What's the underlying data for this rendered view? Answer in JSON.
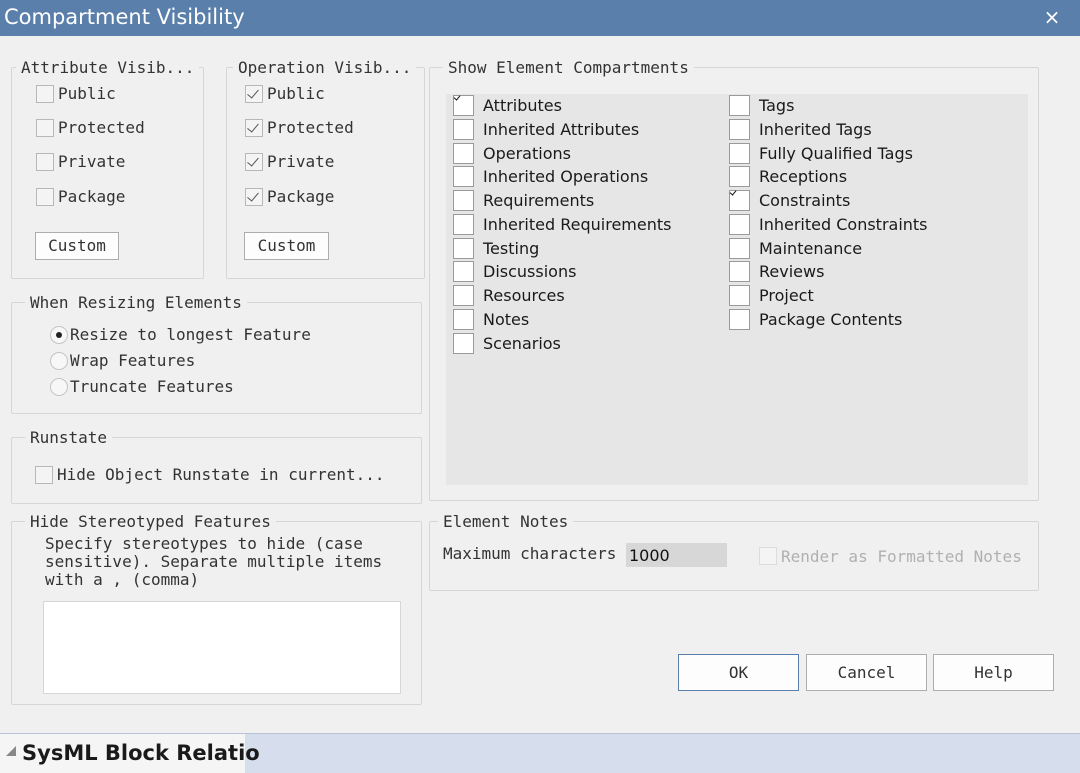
{
  "window": {
    "title": "Compartment Visibility",
    "close_glyph": "×"
  },
  "attribute_visibility": {
    "legend": "Attribute Visib...",
    "items": [
      {
        "label": "Public",
        "checked": false
      },
      {
        "label": "Protected",
        "checked": false
      },
      {
        "label": "Private",
        "checked": false
      },
      {
        "label": "Package",
        "checked": false
      }
    ],
    "custom_label": "Custom"
  },
  "operation_visibility": {
    "legend": "Operation Visib...",
    "items": [
      {
        "label": "Public",
        "checked": true
      },
      {
        "label": "Protected",
        "checked": true
      },
      {
        "label": "Private",
        "checked": true
      },
      {
        "label": "Package",
        "checked": true
      }
    ],
    "custom_label": "Custom"
  },
  "resizing": {
    "legend": "When Resizing Elements",
    "options": [
      {
        "label": "Resize to longest Feature",
        "selected": true
      },
      {
        "label": "Wrap Features",
        "selected": false
      },
      {
        "label": "Truncate Features",
        "selected": false
      }
    ]
  },
  "runstate": {
    "legend": "Runstate",
    "checkbox_label": "Hide Object Runstate in current...",
    "checked": false
  },
  "stereotyped": {
    "legend": "Hide Stereotyped Features",
    "desc_line1": "Specify stereotypes to hide (case",
    "desc_line2": "sensitive). Separate multiple items",
    "desc_line3": "with a , (comma)",
    "value": ""
  },
  "show_compartments": {
    "legend": "Show Element Compartments",
    "col1": [
      {
        "label": "Attributes",
        "checked": true
      },
      {
        "label": "Inherited Attributes",
        "checked": false
      },
      {
        "label": "Operations",
        "checked": false
      },
      {
        "label": "Inherited Operations",
        "checked": false
      },
      {
        "label": "Requirements",
        "checked": false
      },
      {
        "label": "Inherited Requirements",
        "checked": false
      },
      {
        "label": "Testing",
        "checked": false
      },
      {
        "label": "Discussions",
        "checked": false
      },
      {
        "label": "Resources",
        "checked": false
      },
      {
        "label": "Notes",
        "checked": false
      },
      {
        "label": "Scenarios",
        "checked": false
      }
    ],
    "col2": [
      {
        "label": "Tags",
        "checked": false
      },
      {
        "label": "Inherited Tags",
        "checked": false
      },
      {
        "label": "Fully Qualified Tags",
        "checked": false
      },
      {
        "label": "Receptions",
        "checked": false
      },
      {
        "label": "Constraints",
        "checked": true
      },
      {
        "label": "Inherited Constraints",
        "checked": false
      },
      {
        "label": "Maintenance",
        "checked": false
      },
      {
        "label": "Reviews",
        "checked": false
      },
      {
        "label": "Project",
        "checked": false
      },
      {
        "label": "Package Contents",
        "checked": false
      }
    ]
  },
  "element_notes": {
    "legend": "Element Notes",
    "max_label": "Maximum characters",
    "max_value": "1000",
    "render_label": "Render as Formatted Notes",
    "render_checked": false
  },
  "buttons": {
    "ok": "OK",
    "cancel": "Cancel",
    "help": "Help"
  },
  "bottom": {
    "tab_label": "SysML Block Relatio"
  }
}
